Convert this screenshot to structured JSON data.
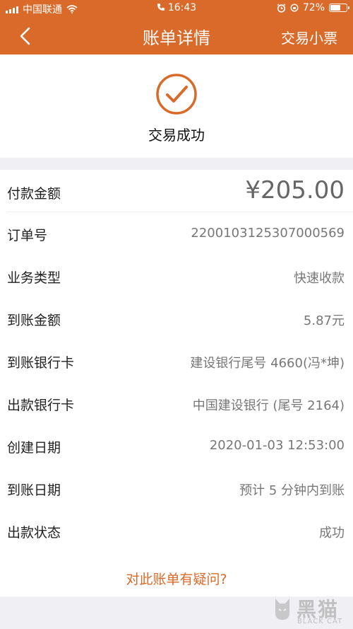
{
  "status_bar": {
    "carrier": "中国联通",
    "time": "16:43",
    "battery": "72%",
    "battery_level": 0.72
  },
  "nav": {
    "title": "账单详情",
    "receipt_label": "交易小票"
  },
  "success": {
    "text": "交易成功"
  },
  "details": [
    {
      "label": "付款金额",
      "value": "¥205.00"
    },
    {
      "label": "订单号",
      "value": "2200103125307000569"
    },
    {
      "label": "业务类型",
      "value": "快速收款"
    },
    {
      "label": "到账金额",
      "value": "5.87元"
    },
    {
      "label": "到账银行卡",
      "value": "建设银行尾号 4660(冯*坤)"
    },
    {
      "label": "出款银行卡",
      "value": "中国建设银行 (尾号 2164)"
    },
    {
      "label": "创建日期",
      "value": "2020-01-03 12:53:00"
    },
    {
      "label": "到账日期",
      "value": "预计 5 分钟内到账"
    },
    {
      "label": "出款状态",
      "value": "成功"
    }
  ],
  "question_link": "对此账单有疑问?",
  "watermark": {
    "main": "黑猫",
    "sub": "BLACK CAT"
  },
  "colors": {
    "accent": "#d96a2a",
    "background": "#efeff4"
  }
}
